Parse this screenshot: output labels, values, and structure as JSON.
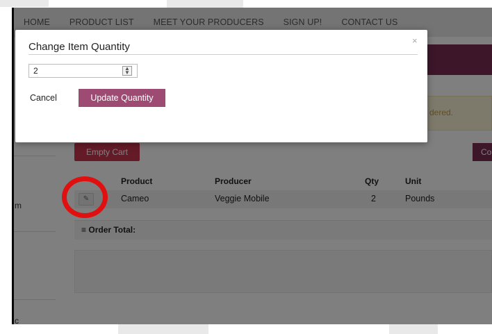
{
  "nav": {
    "items": [
      "HOME",
      "PRODUCT LIST",
      "MEET YOUR PRODUCERS",
      "SIGN UP!",
      "CONTACT US"
    ]
  },
  "alert": {
    "text": "dered."
  },
  "sidebar": {
    "label_fragment": "m",
    "bottom_fragment": "c"
  },
  "cart": {
    "empty_label": "Empty Cart",
    "checkout_fragment": "Co",
    "columns": [
      "Product",
      "Producer",
      "Qty",
      "Unit"
    ],
    "rows": [
      {
        "product": "Cameo",
        "producer": "Veggie Mobile",
        "qty": "2",
        "unit": "Pounds"
      }
    ],
    "order_total_label": "Order Total:"
  },
  "modal": {
    "title": "Change Item Quantity",
    "close": "×",
    "quantity_value": "2",
    "cancel_label": "Cancel",
    "update_label": "Update Quantity"
  },
  "colors": {
    "brand": "#7b2d55",
    "update_button": "#9e4b73",
    "danger": "#c9374e",
    "annotation": "#e01010"
  },
  "icons": {
    "edit": "pencil-square-icon",
    "list": "list-icon",
    "spinner": "spinner-arrows-icon"
  }
}
